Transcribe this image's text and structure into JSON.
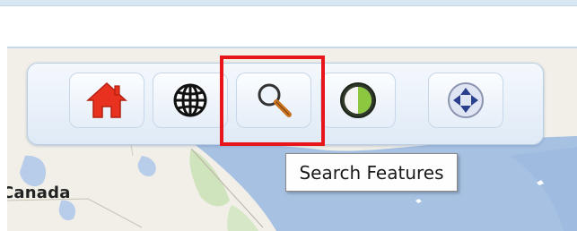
{
  "map": {
    "place_label": "Canada"
  },
  "toolbar": {
    "buttons": [
      {
        "id": "home",
        "icon": "home-icon",
        "color": "#e8321f"
      },
      {
        "id": "basemap",
        "icon": "globe-icon",
        "color": "#1a1a1a"
      },
      {
        "id": "search",
        "icon": "magnifier-icon",
        "color": "#c8731f",
        "highlighted": true
      },
      {
        "id": "overview",
        "icon": "half-circle-icon",
        "color": "#8dc63f"
      },
      {
        "id": "pan",
        "icon": "pan-arrows-icon",
        "color": "#2b3f8f"
      }
    ]
  },
  "tooltip": {
    "text": "Search Features"
  },
  "colors": {
    "highlight": "#e8151b",
    "toolbar_bg": "#e6eef8",
    "map_water": "#a7c1e2",
    "map_land": "#f1efe8"
  }
}
